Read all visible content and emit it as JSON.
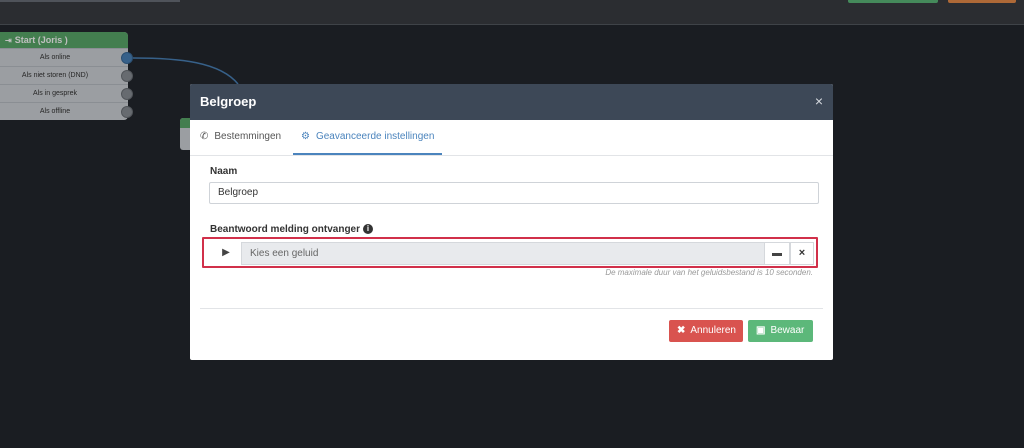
{
  "canvas": {
    "node": {
      "title": "Start (Joris )",
      "rows": [
        "Als online",
        "Als niet storen (DND)",
        "Als in gesprek",
        "Als offline"
      ]
    }
  },
  "modal": {
    "title": "Belgroep",
    "close_glyph": "×",
    "tabs": [
      {
        "label": "Bestemmingen",
        "icon": "phone-icon"
      },
      {
        "label": "Geavanceerde instellingen",
        "icon": "gear-icon"
      }
    ],
    "active_tab": 1,
    "name_label": "Naam",
    "name_value": "Belgroep",
    "answer_label": "Beantwoord melding ontvanger",
    "sound_placeholder": "Kies een geluid",
    "hint": "De maximale duur van het geluidsbestand is 10 seconden.",
    "cancel_label": "Annuleren",
    "save_label": "Bewaar"
  },
  "colors": {
    "header": "#3d4857",
    "accent": "#4b84bd",
    "highlight": "#d1304a",
    "cancel": "#d9534f",
    "save": "#5cb87a"
  }
}
